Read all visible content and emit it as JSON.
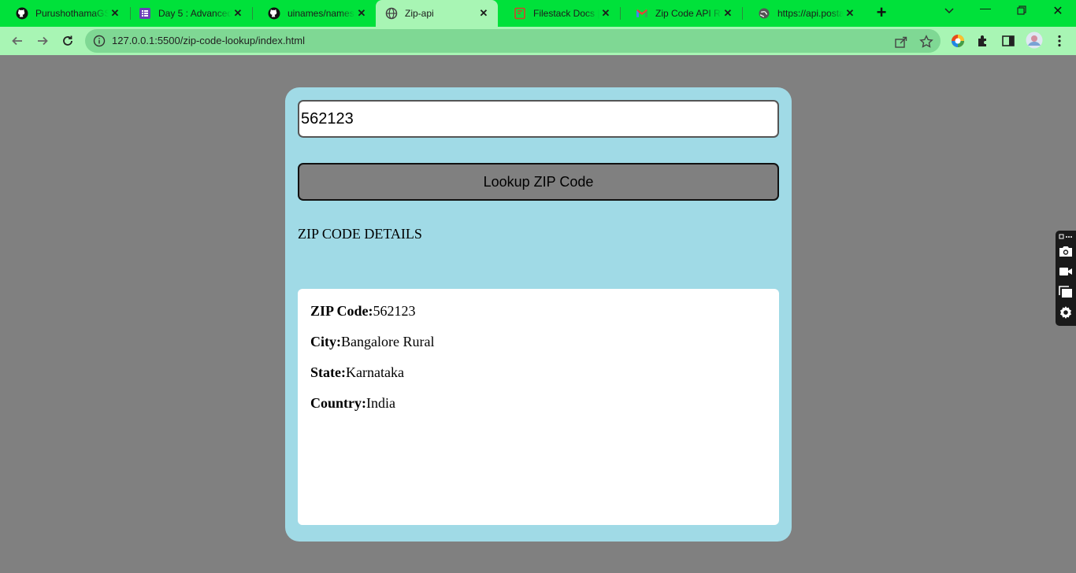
{
  "browser": {
    "tabs": [
      {
        "title": "PurushothamaGS",
        "icon": "github-icon"
      },
      {
        "title": "Day 5 : Advanced",
        "icon": "form-icon"
      },
      {
        "title": "uinames/names.j",
        "icon": "github-icon"
      },
      {
        "title": "Zip-api",
        "icon": "globe-icon",
        "active": true
      },
      {
        "title": "Filestack Docs | F",
        "icon": "filestack-icon"
      },
      {
        "title": "Zip Code API Rep",
        "icon": "gmail-icon"
      },
      {
        "title": "https://api.postal",
        "icon": "globe-icon"
      }
    ],
    "url": "127.0.0.1:5500/zip-code-lookup/index.html",
    "accent_color": "#00e13a",
    "toolbar_color": "#a8f5b4"
  },
  "form": {
    "zip_value": "562123",
    "button_label": "Lookup ZIP Code"
  },
  "details": {
    "heading": "ZIP CODE DETAILS",
    "rows": [
      {
        "label": "ZIP Code:",
        "value": "562123"
      },
      {
        "label": "City:",
        "value": "Bangalore Rural"
      },
      {
        "label": "State:",
        "value": "Karnataka"
      },
      {
        "label": "Country:",
        "value": "India"
      }
    ]
  },
  "colors": {
    "page_bg": "#808080",
    "card_bg": "#a0dae6",
    "button_bg": "#808080"
  }
}
